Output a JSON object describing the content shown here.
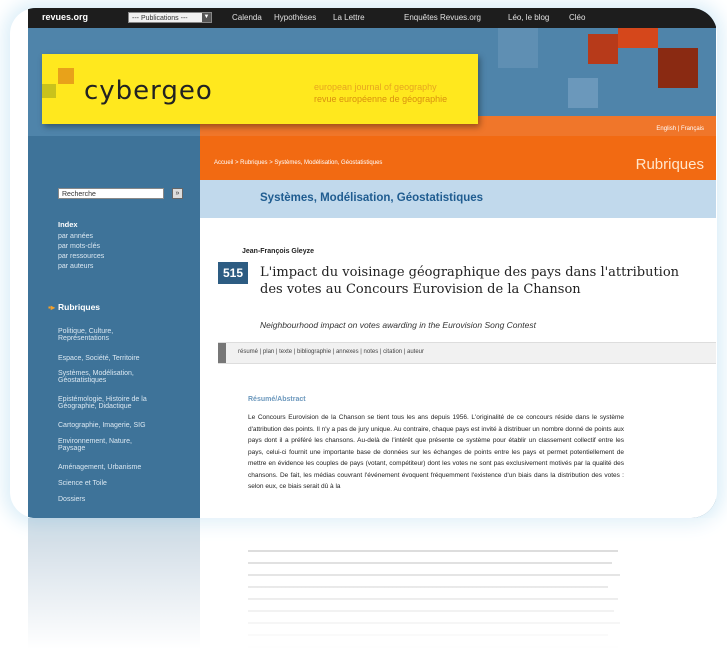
{
  "topnav": {
    "logo": "revues.org",
    "publications_select": "--- Publications ---",
    "links": [
      "Calenda",
      "Hypothèses",
      "La Lettre",
      "Enquêtes Revues.org",
      "Léo, le blog",
      "Cléo"
    ]
  },
  "header": {
    "logo_text": "cybergeo",
    "tagline_en": "european journal of geography",
    "tagline_fr": "revue européenne de géographie",
    "lang_links": "English | Français",
    "breadcrumb": "Accueil > Rubriques > Systèmes, Modélisation, Géostatistiques",
    "section_heading": "Rubriques"
  },
  "sidebar": {
    "search_label": "Recherche",
    "index_heading": "Index",
    "index_links": [
      "par années",
      "par mots-clés",
      "par ressources",
      "par auteurs"
    ],
    "rubriques_heading": "Rubriques",
    "rubriques": [
      "Politique, Culture, Représentations",
      "Espace, Société, Territoire",
      "Systèmes, Modélisation, Géostatistiques",
      "Epistémologie, Histoire de la Géographie, Didactique",
      "Cartographie, Imagerie, SIG",
      "Environnement, Nature, Paysage",
      "Aménagement, Urbanisme",
      "Science et Toile",
      "Dossiers"
    ]
  },
  "content": {
    "section_title": "Systèmes, Modélisation, Géostatistiques",
    "author": "Jean-François Gleyze",
    "number": "515",
    "title": "L'impact du voisinage géographique des pays dans l'attribution des votes au Concours Eurovision de la Chanson",
    "subtitle": "Neighbourhood impact on votes awarding in the Eurovision Song Contest",
    "toolbar_links": "résumé | plan | texte | bibliographie | annexes | notes | citation | auteur",
    "abstract_heading": "Résumé/Abstract",
    "abstract_text": "Le Concours Eurovision de la Chanson se tient tous les ans depuis 1956. L'originalité de ce concours réside dans le système d'attribution des points. Il n'y a pas de jury unique. Au contraire, chaque pays est invité à distribuer un nombre donné de points aux pays dont il a préféré les chansons. Au-delà de l'intérêt que présente ce système pour établir un classement collectif entre les pays, celui-ci fournit une importante base de données sur les échanges de points entre les pays et permet potentiellement de mettre en évidence les couples de pays (votant, compétiteur) dont les votes ne sont pas exclusivement motivés par la qualité des chansons. De fait, les médias couvrant l'événement évoquent fréquemment l'existence d'un biais dans la distribution des votes : selon eux, ce biais serait dû à la"
  },
  "colors": {
    "sidebar": "#3e7399",
    "orange": "#f26a12",
    "logo_yellow": "#ffe81e",
    "title_blue": "#1f5c90"
  }
}
